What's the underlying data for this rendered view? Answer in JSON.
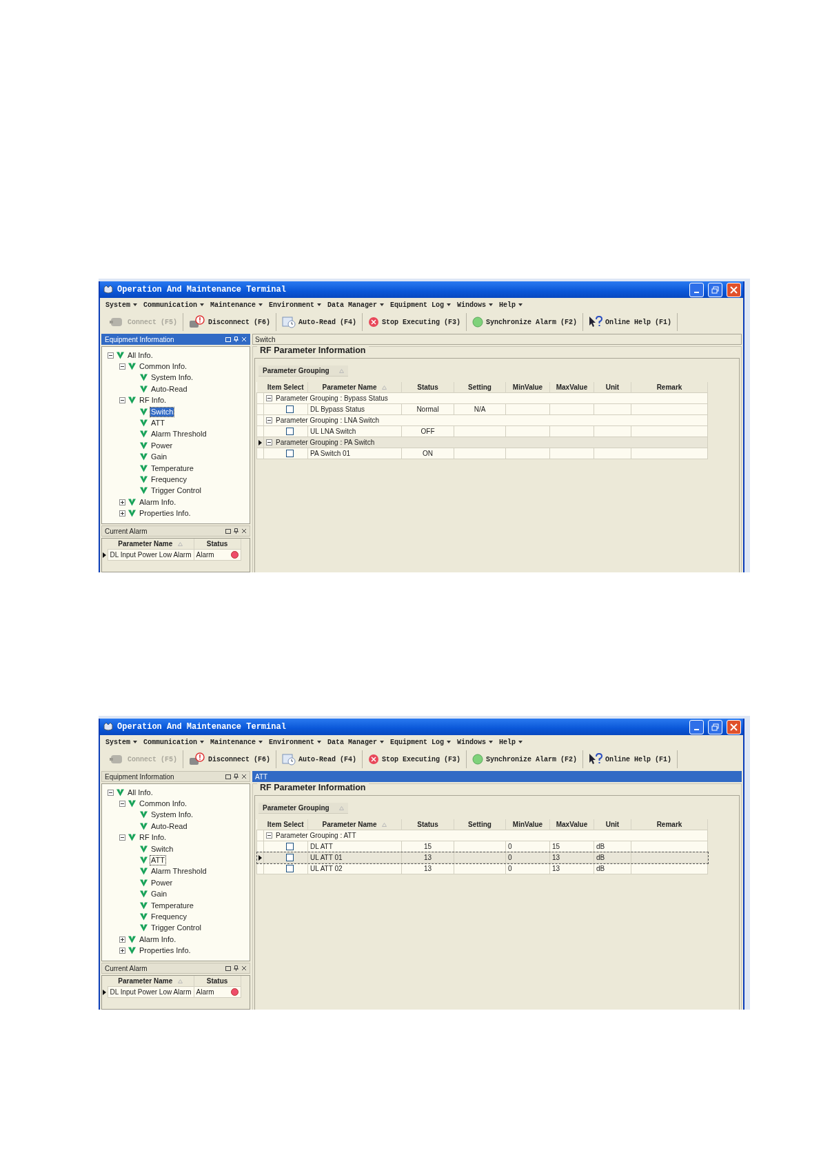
{
  "screens": [
    {
      "title": "Operation And Maintenance Terminal",
      "menu": [
        "System",
        "Communication",
        "Maintenance",
        "Environment",
        "Data Manager",
        "Equipment Log",
        "Windows",
        "Help"
      ],
      "toolbar": [
        {
          "label": "Connect (F5)",
          "kind": "connect",
          "disabled": true
        },
        {
          "label": "Disconnect (F6)",
          "kind": "disconnect",
          "disabled": false
        },
        {
          "label": "Auto-Read (F4)",
          "kind": "autoread",
          "disabled": false
        },
        {
          "label": "Stop Executing (F3)",
          "kind": "stop",
          "disabled": false
        },
        {
          "label": "Synchronize Alarm (F2)",
          "kind": "sync",
          "disabled": false
        },
        {
          "label": "Online Help (F1)",
          "kind": "help",
          "disabled": false
        }
      ],
      "equipment_panel": {
        "title": "Equipment Information",
        "active": true,
        "tree": [
          {
            "label": "All Info.",
            "expanded": true,
            "selected": false,
            "children": [
              {
                "label": "Common Info.",
                "expanded": true,
                "selected": false,
                "children": [
                  {
                    "label": "System Info.",
                    "selected": false
                  },
                  {
                    "label": "Auto-Read",
                    "selected": false
                  }
                ]
              },
              {
                "label": "RF Info.",
                "expanded": true,
                "selected": false,
                "children": [
                  {
                    "label": "Switch",
                    "selected": true
                  },
                  {
                    "label": "ATT",
                    "selected": false
                  },
                  {
                    "label": "Alarm Threshold",
                    "selected": false
                  },
                  {
                    "label": "Power",
                    "selected": false
                  },
                  {
                    "label": "Gain",
                    "selected": false
                  },
                  {
                    "label": "Temperature",
                    "selected": false
                  },
                  {
                    "label": "Frequency",
                    "selected": false
                  },
                  {
                    "label": "Trigger Control",
                    "selected": false
                  }
                ]
              },
              {
                "label": "Alarm Info.",
                "expanded": false,
                "selected": false
              },
              {
                "label": "Properties Info.",
                "expanded": false,
                "selected": false
              }
            ]
          }
        ]
      },
      "alarm_panel": {
        "title": "Current Alarm",
        "columns": [
          {
            "label": "Parameter Name",
            "sort": true
          },
          {
            "label": "Status",
            "sort": false
          }
        ],
        "rows": [
          {
            "name": "DL Input Power Low Alarm",
            "status": "Alarm",
            "current": true
          }
        ]
      },
      "content": {
        "tab": "Switch",
        "active": false,
        "title": "RF Parameter Information",
        "grouping": "Parameter Grouping",
        "columns": [
          {
            "label": "Item Select",
            "sort": false
          },
          {
            "label": "Parameter Name",
            "sort": true
          },
          {
            "label": "Status",
            "sort": false
          },
          {
            "label": "Setting",
            "sort": false
          },
          {
            "label": "MinValue",
            "sort": false
          },
          {
            "label": "MaxValue",
            "sort": false
          },
          {
            "label": "Unit",
            "sort": false
          },
          {
            "label": "Remark",
            "sort": false
          }
        ],
        "groups": [
          {
            "label": "Parameter Grouping : Bypass Status",
            "expanded": true,
            "current": false,
            "rows": [
              {
                "checked": false,
                "current": false,
                "name": "DL Bypass Status",
                "status": "Normal",
                "setting": "N/A"
              }
            ]
          },
          {
            "label": "Parameter Grouping : LNA Switch",
            "expanded": true,
            "current": false,
            "rows": [
              {
                "checked": false,
                "current": false,
                "name": "UL LNA Switch",
                "status": "OFF"
              }
            ]
          },
          {
            "label": "Parameter Grouping : PA Switch",
            "expanded": true,
            "current": true,
            "rows": [
              {
                "checked": false,
                "current": false,
                "name": "PA Switch 01",
                "status": "ON"
              }
            ]
          }
        ]
      }
    },
    {
      "title": "Operation And Maintenance Terminal",
      "menu": [
        "System",
        "Communication",
        "Maintenance",
        "Environment",
        "Data Manager",
        "Equipment Log",
        "Windows",
        "Help"
      ],
      "toolbar": [
        {
          "label": "Connect (F5)",
          "kind": "connect",
          "disabled": true
        },
        {
          "label": "Disconnect (F6)",
          "kind": "disconnect",
          "disabled": false
        },
        {
          "label": "Auto-Read (F4)",
          "kind": "autoread",
          "disabled": false
        },
        {
          "label": "Stop Executing (F3)",
          "kind": "stop",
          "disabled": false
        },
        {
          "label": "Synchronize Alarm (F2)",
          "kind": "sync",
          "disabled": false
        },
        {
          "label": "Online Help (F1)",
          "kind": "help",
          "disabled": false
        }
      ],
      "equipment_panel": {
        "title": "Equipment Information",
        "active": false,
        "tree": [
          {
            "label": "All Info.",
            "expanded": true,
            "selected": false,
            "children": [
              {
                "label": "Common Info.",
                "expanded": true,
                "selected": false,
                "children": [
                  {
                    "label": "System Info.",
                    "selected": false
                  },
                  {
                    "label": "Auto-Read",
                    "selected": false
                  }
                ]
              },
              {
                "label": "RF Info.",
                "expanded": true,
                "selected": false,
                "children": [
                  {
                    "label": "Switch",
                    "selected": false
                  },
                  {
                    "label": "ATT",
                    "selected": true
                  },
                  {
                    "label": "Alarm Threshold",
                    "selected": false
                  },
                  {
                    "label": "Power",
                    "selected": false
                  },
                  {
                    "label": "Gain",
                    "selected": false
                  },
                  {
                    "label": "Temperature",
                    "selected": false
                  },
                  {
                    "label": "Frequency",
                    "selected": false
                  },
                  {
                    "label": "Trigger Control",
                    "selected": false
                  }
                ]
              },
              {
                "label": "Alarm Info.",
                "expanded": false,
                "selected": false
              },
              {
                "label": "Properties Info.",
                "expanded": false,
                "selected": false
              }
            ]
          }
        ]
      },
      "alarm_panel": {
        "title": "Current Alarm",
        "columns": [
          {
            "label": "Parameter Name",
            "sort": true
          },
          {
            "label": "Status",
            "sort": false
          }
        ],
        "rows": [
          {
            "name": "DL Input Power Low Alarm",
            "status": "Alarm",
            "current": true
          }
        ]
      },
      "content": {
        "tab": "ATT",
        "active": true,
        "title": "RF Parameter Information",
        "grouping": "Parameter Grouping",
        "columns": [
          {
            "label": "Item Select",
            "sort": false
          },
          {
            "label": "Parameter Name",
            "sort": true
          },
          {
            "label": "Status",
            "sort": false
          },
          {
            "label": "Setting",
            "sort": false
          },
          {
            "label": "MinValue",
            "sort": false
          },
          {
            "label": "MaxValue",
            "sort": false
          },
          {
            "label": "Unit",
            "sort": false
          },
          {
            "label": "Remark",
            "sort": false
          }
        ],
        "groups": [
          {
            "label": "Parameter Grouping : ATT",
            "expanded": true,
            "current": false,
            "rows": [
              {
                "checked": false,
                "current": false,
                "name": "DL ATT",
                "status": "15",
                "min": "0",
                "max": "15",
                "unit": "dB"
              },
              {
                "checked": false,
                "current": true,
                "name": "UL ATT 01",
                "status": "13",
                "min": "0",
                "max": "13",
                "unit": "dB"
              },
              {
                "checked": false,
                "current": false,
                "name": "UL ATT 02",
                "status": "13",
                "min": "0",
                "max": "13",
                "unit": "dB"
              }
            ]
          }
        ]
      }
    }
  ]
}
